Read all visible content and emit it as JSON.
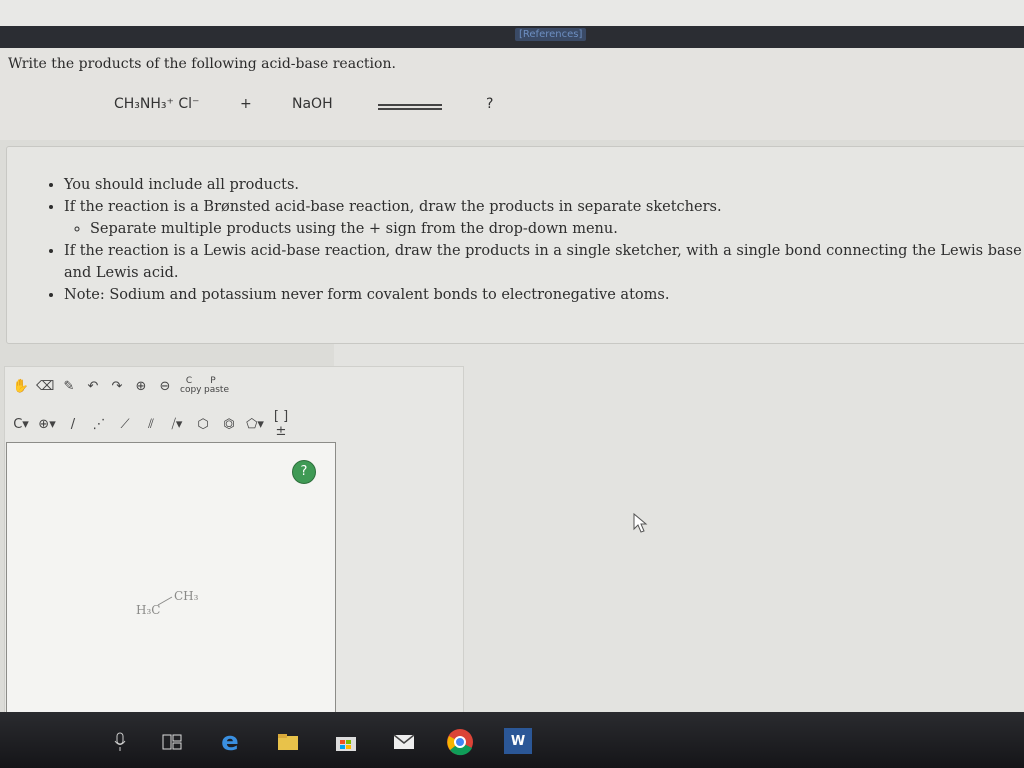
{
  "header": {
    "references_label": "[References]"
  },
  "question": {
    "prompt": "Write the products of the following acid-base reaction.",
    "reactant1": "CH₃NH₃⁺ Cl⁻",
    "plus": "+",
    "reactant2": "NaOH",
    "product": "?"
  },
  "instructions": {
    "items": [
      "You should include all products.",
      "If the reaction is a Brønsted acid-base reaction, draw the products in separate sketchers.",
      "If the reaction is a Lewis acid-base reaction, draw the products in a single sketcher, with a single bond connecting the Lewis base and Lewis acid.",
      "Note: Sodium and potassium never form covalent bonds to electronegative atoms."
    ],
    "subitem": "Separate multiple products using the + sign from the drop-down menu."
  },
  "sketcher": {
    "toolbar1": [
      "hand-icon",
      "eraser-icon",
      "pencil-icon",
      "undo-icon",
      "redo-icon",
      "zoom-in-icon",
      "zoom-out-icon"
    ],
    "copy_label": "C",
    "copy_sub": "copy",
    "paste_label": "P",
    "paste_sub": "paste",
    "atom_label": "C",
    "charge_label": "⊕",
    "bracket_label": "[ ]±",
    "help_label": "?",
    "molecule": {
      "left": "H₃C",
      "right": "CH₃"
    }
  },
  "taskbar": {
    "icons": [
      "microphone-icon",
      "task-view-icon",
      "edge-icon",
      "file-explorer-icon",
      "store-icon",
      "mail-icon",
      "chrome-icon",
      "word-icon"
    ],
    "word_label": "W"
  }
}
